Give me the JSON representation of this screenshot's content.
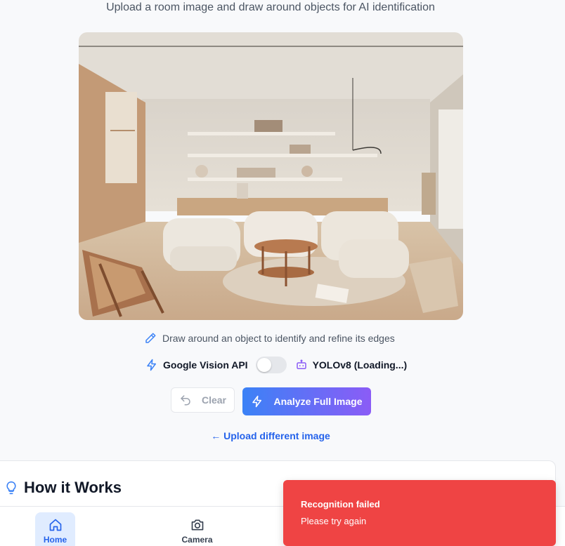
{
  "header": {
    "subtitle": "Upload a room image and draw around objects for AI identification"
  },
  "image": {
    "description_icon": "room-photo"
  },
  "hint": {
    "icon": "pencil-icon",
    "text": "Draw around an object to identify and refine its edges"
  },
  "engines": {
    "google": {
      "icon": "lightning-icon",
      "label": "Google Vision API"
    },
    "toggle_on": false,
    "yolo": {
      "icon": "bot-icon",
      "label": "YOLOv8 (Loading...)"
    }
  },
  "actions": {
    "clear_label": "Clear",
    "analyze_label": "Analyze Full Image",
    "upload_link": "← Upload different image"
  },
  "how_it_works": {
    "title": "How it Works"
  },
  "nav": {
    "items": [
      {
        "label": "Home",
        "icon": "home-icon",
        "active": true
      },
      {
        "label": "Camera",
        "icon": "camera-icon",
        "active": false
      }
    ]
  },
  "toast": {
    "title": "Recognition failed",
    "message": "Please try again"
  },
  "colors": {
    "accent": "#3b82f6",
    "accent_2": "#8b5cf6",
    "error": "#ef4444",
    "link": "#2563eb"
  }
}
